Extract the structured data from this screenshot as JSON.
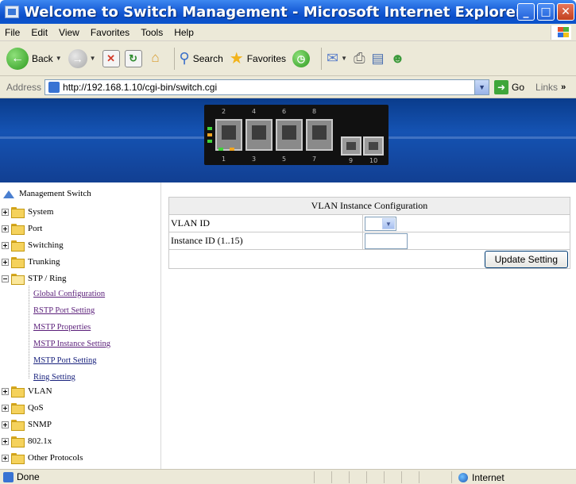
{
  "window": {
    "title": "Welcome to Switch Management - Microsoft Internet Explorer",
    "min_glyph": "_",
    "max_glyph": "□",
    "close_glyph": "✕"
  },
  "menu": [
    "File",
    "Edit",
    "View",
    "Favorites",
    "Tools",
    "Help"
  ],
  "toolbar": {
    "back_label": "Back",
    "search_label": "Search",
    "favorites_label": "Favorites"
  },
  "address": {
    "label": "Address",
    "url": "http://192.168.1.10/cgi-bin/switch.cgi",
    "go_label": "Go",
    "links_label": "Links",
    "links_more": "»"
  },
  "sidebar": {
    "root": "Management Switch",
    "items": [
      {
        "label": "System",
        "expanded": false
      },
      {
        "label": "Port",
        "expanded": false
      },
      {
        "label": "Switching",
        "expanded": false
      },
      {
        "label": "Trunking",
        "expanded": false
      },
      {
        "label": "STP / Ring",
        "expanded": true
      },
      {
        "label": "VLAN",
        "expanded": false
      },
      {
        "label": "QoS",
        "expanded": false
      },
      {
        "label": "SNMP",
        "expanded": false
      },
      {
        "label": "802.1x",
        "expanded": false
      },
      {
        "label": "Other Protocols",
        "expanded": false
      }
    ],
    "stp_children": [
      {
        "label": "Global Configuration",
        "visited": true
      },
      {
        "label": "RSTP Port Setting",
        "visited": true
      },
      {
        "label": "MSTP Properties",
        "visited": true
      },
      {
        "label": "MSTP Instance Setting",
        "visited": true
      },
      {
        "label": "MSTP Port Setting",
        "visited": false
      },
      {
        "label": "Ring Setting",
        "visited": false
      }
    ]
  },
  "content": {
    "title": "VLAN Instance Configuration",
    "vlan_id_label": "VLAN ID",
    "vlan_id_value": "",
    "instance_id_label": "Instance ID (1..15)",
    "instance_id_value": "",
    "update_button": "Update Setting"
  },
  "statusbar": {
    "status": "Done",
    "zone": "Internet"
  },
  "colors": {
    "titlebar": "#0b4ec9",
    "banner": "#1553b3",
    "link": "#1a237e",
    "visited_link": "#5b1f7a"
  }
}
